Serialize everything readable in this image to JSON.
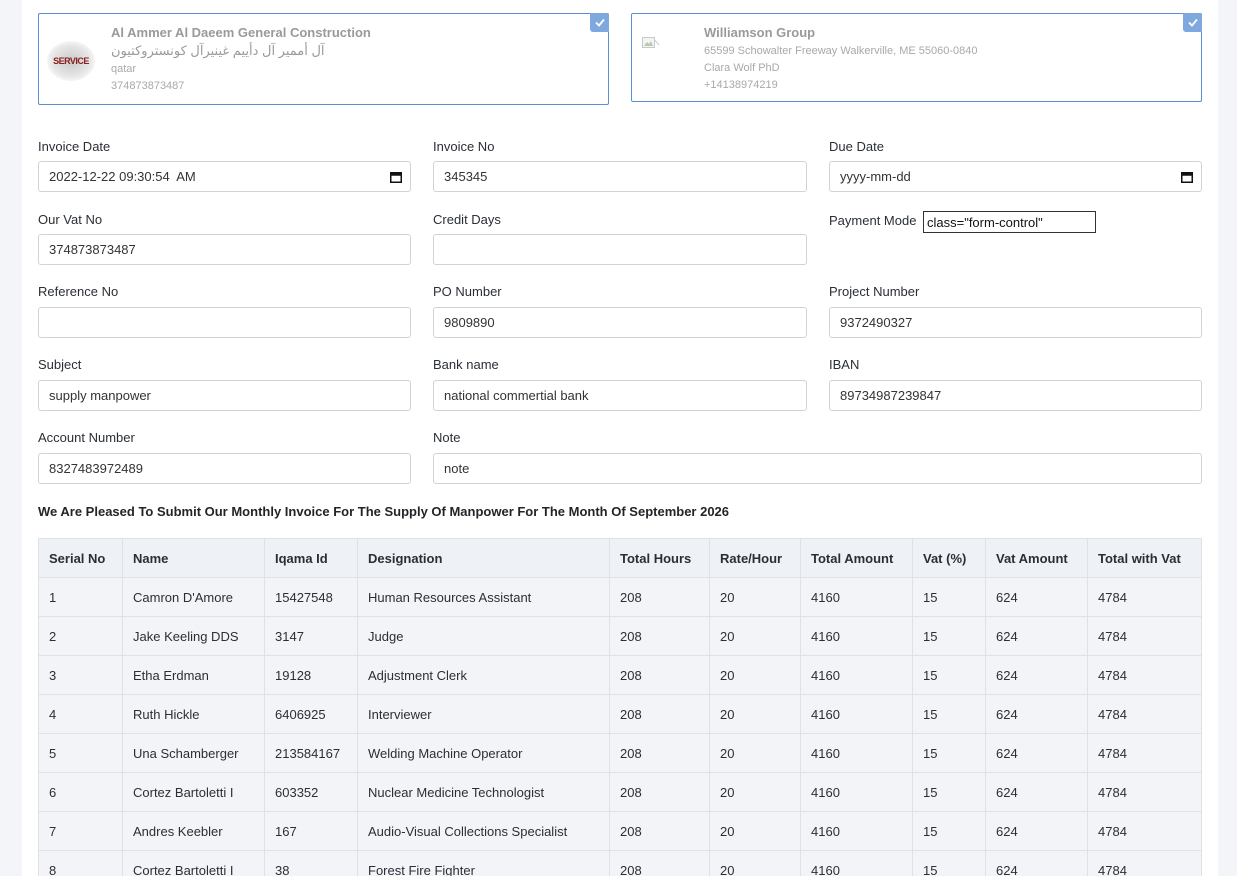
{
  "sender": {
    "name": "Al Ammer Al Daeem General Construction",
    "name_arabic": "آل أممير آل دأييم غينيرآل كونستروكتيون",
    "country": "qatar",
    "phone": "374873873487",
    "logo_text": "SERVICE",
    "selected": true
  },
  "client": {
    "name": "Williamson Group",
    "address": "65599 Schowalter Freeway Walkerville, ME 55060-0840",
    "contact": "Clara Wolf PhD",
    "phone": "+14138974219",
    "selected": true
  },
  "form": {
    "invoice_date": {
      "label": "Invoice Date",
      "value": "2022-12-22 09:30:54  AM"
    },
    "invoice_no": {
      "label": "Invoice No",
      "value": "345345"
    },
    "due_date": {
      "label": "Due Date",
      "value": "yyyy-mm-dd"
    },
    "vat_no": {
      "label": "Our Vat No",
      "value": "374873873487"
    },
    "credit_days": {
      "label": "Credit Days",
      "value": ""
    },
    "payment_mode": {
      "label": "Payment Mode",
      "value": "class=\"form-control\""
    },
    "reference_no": {
      "label": "Reference No",
      "value": ""
    },
    "po_number": {
      "label": "PO Number",
      "value": "9809890"
    },
    "project_number": {
      "label": "Project Number",
      "value": "9372490327"
    },
    "subject": {
      "label": "Subject",
      "value": "supply manpower"
    },
    "bank_name": {
      "label": "Bank name",
      "value": "national commertial bank"
    },
    "iban": {
      "label": "IBAN",
      "value": "89734987239847"
    },
    "account_number": {
      "label": "Account Number",
      "value": "8327483972489"
    },
    "note": {
      "label": "Note",
      "value": "note"
    }
  },
  "heading": "We Are Pleased To Submit Our Monthly Invoice For The Supply Of Manpower For The Month Of September 2026",
  "table": {
    "headers": [
      "Serial No",
      "Name",
      "Iqama Id",
      "Designation",
      "Total Hours",
      "Rate/Hour",
      "Total Amount",
      "Vat (%)",
      "Vat Amount",
      "Total with Vat"
    ],
    "rows": [
      [
        "1",
        "Camron D'Amore",
        "15427548",
        "Human Resources Assistant",
        "208",
        "20",
        "4160",
        "15",
        "624",
        "4784"
      ],
      [
        "2",
        "Jake Keeling DDS",
        "3147",
        "Judge",
        "208",
        "20",
        "4160",
        "15",
        "624",
        "4784"
      ],
      [
        "3",
        "Etha Erdman",
        "19128",
        "Adjustment Clerk",
        "208",
        "20",
        "4160",
        "15",
        "624",
        "4784"
      ],
      [
        "4",
        "Ruth Hickle",
        "6406925",
        "Interviewer",
        "208",
        "20",
        "4160",
        "15",
        "624",
        "4784"
      ],
      [
        "5",
        "Una Schamberger",
        "213584167",
        "Welding Machine Operator",
        "208",
        "20",
        "4160",
        "15",
        "624",
        "4784"
      ],
      [
        "6",
        "Cortez Bartoletti I",
        "603352",
        "Nuclear Medicine Technologist",
        "208",
        "20",
        "4160",
        "15",
        "624",
        "4784"
      ],
      [
        "7",
        "Andres Keebler",
        "167",
        "Audio-Visual Collections Specialist",
        "208",
        "20",
        "4160",
        "15",
        "624",
        "4784"
      ],
      [
        "8",
        "Cortez Bartoletti I",
        "38",
        "Forest Fire Fighter",
        "208",
        "20",
        "4160",
        "15",
        "624",
        "4784"
      ]
    ]
  }
}
